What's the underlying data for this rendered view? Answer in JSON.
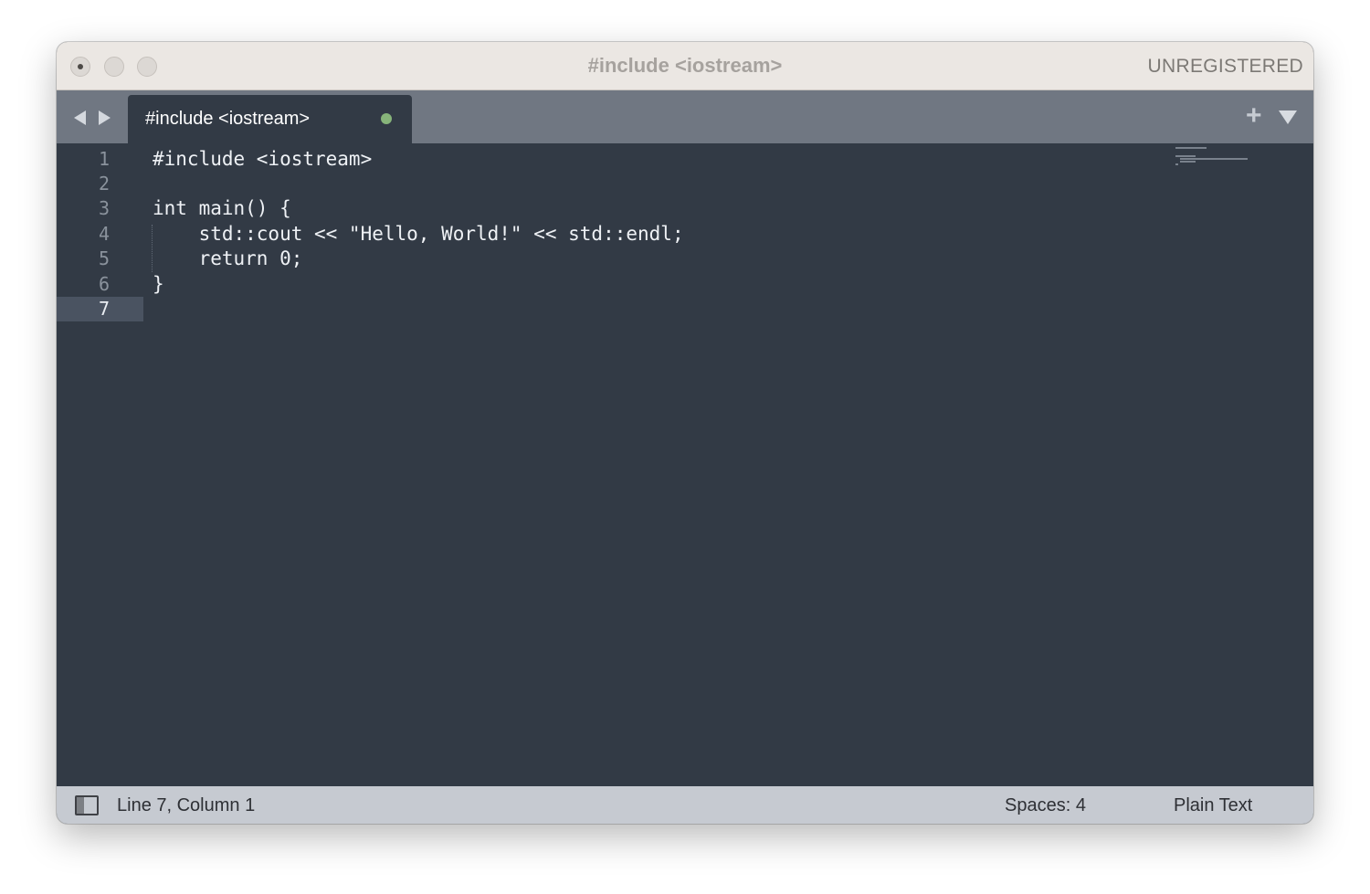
{
  "window": {
    "title": "#include <iostream>",
    "registration": "UNREGISTERED"
  },
  "tabs": [
    {
      "label": "#include <iostream>",
      "dirty": true,
      "active": true
    }
  ],
  "editor": {
    "lines": [
      {
        "number": "1",
        "text": "#include <iostream>"
      },
      {
        "number": "2",
        "text": ""
      },
      {
        "number": "3",
        "text": "int main() {"
      },
      {
        "number": "4",
        "text": "    std::cout << \"Hello, World!\" << std::endl;"
      },
      {
        "number": "5",
        "text": "    return 0;"
      },
      {
        "number": "6",
        "text": "}"
      },
      {
        "number": "7",
        "text": ""
      }
    ],
    "current_line": "7"
  },
  "statusbar": {
    "position": "Line 7, Column 1",
    "indentation": "Spaces: 4",
    "syntax": "Plain Text"
  },
  "colors": {
    "editor_bg": "#323a45",
    "tabbar_bg": "#707782",
    "titlebar_bg": "#ebe7e3",
    "statusbar_bg": "#c6cad1",
    "dirty_indicator": "#87b47a"
  },
  "icons": {
    "nav_back": "triangle-left-icon",
    "nav_forward": "triangle-right-icon",
    "new_tab": "plus-icon",
    "tab_menu": "triangle-down-icon",
    "sidebar": "sidebar-toggle-icon"
  }
}
